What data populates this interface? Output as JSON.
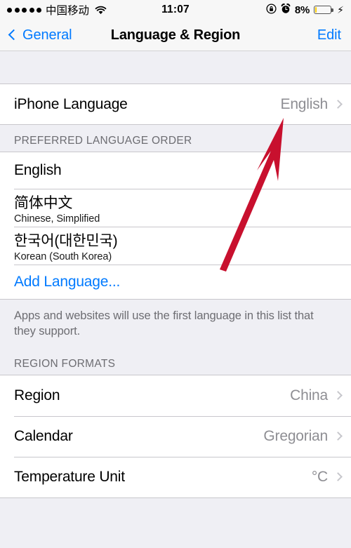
{
  "status_bar": {
    "signal_dots": 5,
    "carrier": "中国移动",
    "wifi_icon": "wifi-icon",
    "time": "11:07",
    "rotation_lock_icon": "rotation-lock-icon",
    "alarm_icon": "alarm-clock-icon",
    "battery_percent": "8%",
    "battery_level": 8,
    "charging_icon": "lightning-bolt-icon",
    "battery_color": "#FFCC00"
  },
  "nav_bar": {
    "back_label": "General",
    "back_icon": "chevron-left-icon",
    "title": "Language & Region",
    "edit_label": "Edit"
  },
  "sections": {
    "iphone_language": {
      "rows": [
        {
          "title": "iPhone Language",
          "value": "English"
        }
      ]
    },
    "preferred_language_order": {
      "header": "PREFERRED LANGUAGE ORDER",
      "rows": [
        {
          "title": "English",
          "subtitle": ""
        },
        {
          "title": "简体中文",
          "subtitle": "Chinese, Simplified"
        },
        {
          "title": "한국어(대한민국)",
          "subtitle": "Korean (South Korea)"
        }
      ],
      "add_language_label": "Add Language...",
      "footer": "Apps and websites will use the first language in this list that they support."
    },
    "region_formats": {
      "header": "REGION FORMATS",
      "rows": [
        {
          "title": "Region",
          "value": "China"
        },
        {
          "title": "Calendar",
          "value": "Gregorian"
        },
        {
          "title": "Temperature Unit",
          "value": "°C"
        }
      ]
    }
  },
  "annotation": {
    "arrow_color": "#C8102E",
    "arrow_name": "red-pointer-arrow",
    "points_at": "English"
  },
  "theme": {
    "accent": "#007AFF",
    "group_bg": "#FFFFFF",
    "table_bg": "#EFEFF4",
    "bar_bg": "#F7F7F7",
    "value_gray": "#8E8E93",
    "separator": "#C8C7CC"
  }
}
